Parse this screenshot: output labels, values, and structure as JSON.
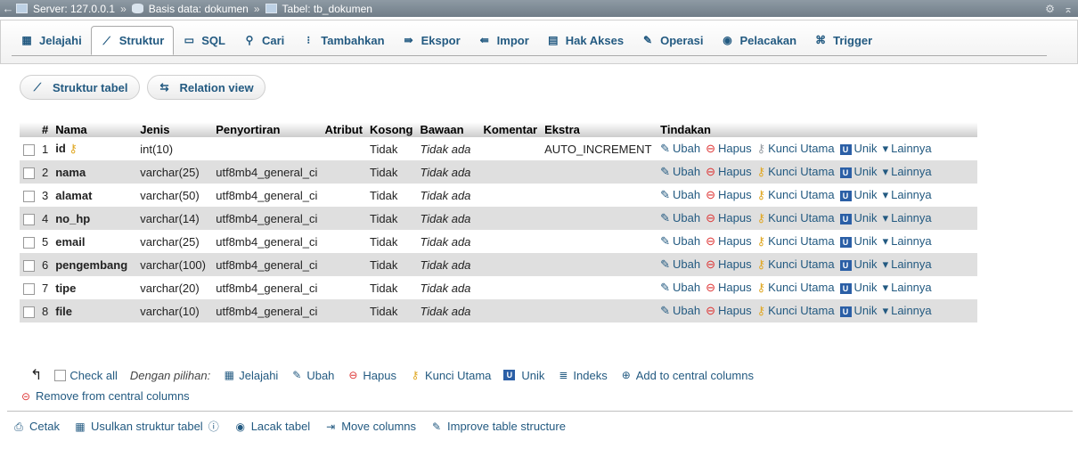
{
  "breadcrumb": {
    "server": "Server: 127.0.0.1",
    "database": "Basis data: dokumen",
    "table": "Tabel: tb_dokumen",
    "separator": "»"
  },
  "tabs": [
    "Jelajahi",
    "Struktur",
    "SQL",
    "Cari",
    "Tambahkan",
    "Ekspor",
    "Impor",
    "Hak Akses",
    "Operasi",
    "Pelacakan",
    "Trigger"
  ],
  "subnav": {
    "structure": "Struktur tabel",
    "relation": "Relation view"
  },
  "table": {
    "headers": [
      "#",
      "Nama",
      "Jenis",
      "Penyortiran",
      "Atribut",
      "Kosong",
      "Bawaan",
      "Komentar",
      "Ekstra",
      "Tindakan"
    ],
    "rows": [
      {
        "n": "1",
        "name": "id",
        "type": "int(10)",
        "coll": "",
        "attr": "",
        "null": "Tidak",
        "def": "Tidak ada",
        "comment": "",
        "extra": "AUTO_INCREMENT"
      },
      {
        "n": "2",
        "name": "nama",
        "type": "varchar(25)",
        "coll": "utf8mb4_general_ci",
        "attr": "",
        "null": "Tidak",
        "def": "Tidak ada",
        "comment": "",
        "extra": ""
      },
      {
        "n": "3",
        "name": "alamat",
        "type": "varchar(50)",
        "coll": "utf8mb4_general_ci",
        "attr": "",
        "null": "Tidak",
        "def": "Tidak ada",
        "comment": "",
        "extra": ""
      },
      {
        "n": "4",
        "name": "no_hp",
        "type": "varchar(14)",
        "coll": "utf8mb4_general_ci",
        "attr": "",
        "null": "Tidak",
        "def": "Tidak ada",
        "comment": "",
        "extra": ""
      },
      {
        "n": "5",
        "name": "email",
        "type": "varchar(25)",
        "coll": "utf8mb4_general_ci",
        "attr": "",
        "null": "Tidak",
        "def": "Tidak ada",
        "comment": "",
        "extra": ""
      },
      {
        "n": "6",
        "name": "pengembang",
        "type": "varchar(100)",
        "coll": "utf8mb4_general_ci",
        "attr": "",
        "null": "Tidak",
        "def": "Tidak ada",
        "comment": "",
        "extra": ""
      },
      {
        "n": "7",
        "name": "tipe",
        "type": "varchar(20)",
        "coll": "utf8mb4_general_ci",
        "attr": "",
        "null": "Tidak",
        "def": "Tidak ada",
        "comment": "",
        "extra": ""
      },
      {
        "n": "8",
        "name": "file",
        "type": "varchar(10)",
        "coll": "utf8mb4_general_ci",
        "attr": "",
        "null": "Tidak",
        "def": "Tidak ada",
        "comment": "",
        "extra": ""
      }
    ],
    "actions": {
      "edit": "Ubah",
      "drop": "Hapus",
      "primary": "Kunci Utama",
      "unique": "Unik",
      "more": "Lainnya"
    }
  },
  "with_selected": {
    "check_all": "Check all",
    "label": "Dengan pilihan:",
    "browse": "Jelajahi",
    "edit": "Ubah",
    "drop": "Hapus",
    "primary": "Kunci Utama",
    "unique": "Unik",
    "index": "Indeks",
    "add_central": "Add to central columns",
    "remove_central": "Remove from central columns"
  },
  "bottom": {
    "print": "Cetak",
    "propose": "Usulkan struktur tabel",
    "track": "Lacak tabel",
    "move": "Move columns",
    "improve": "Improve table structure"
  },
  "colors": {
    "link": "#235a81",
    "row_alt": "#dfdfdf",
    "topbar": "#7b8893"
  }
}
